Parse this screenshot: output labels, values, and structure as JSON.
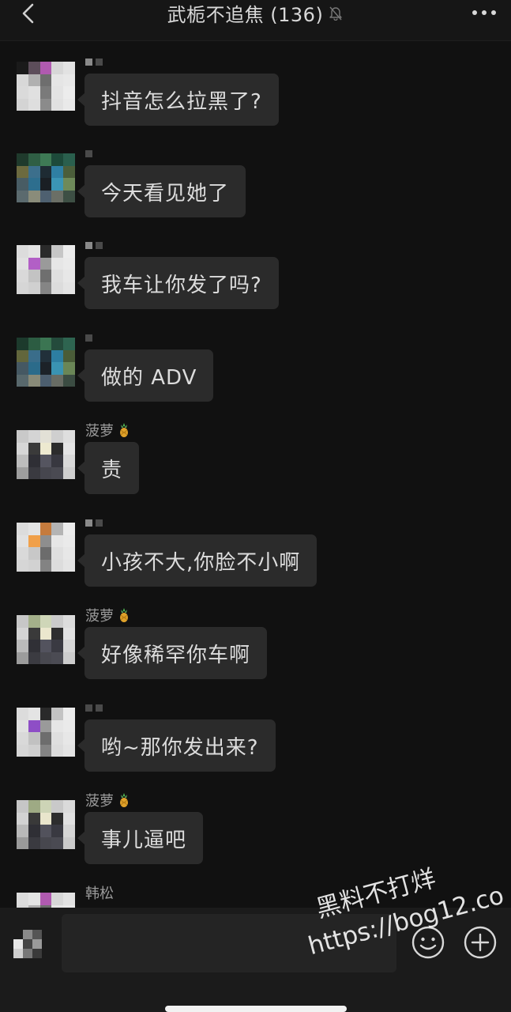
{
  "header": {
    "back_icon": "chevron-left-icon",
    "title": "武栀不追焦 (136)",
    "mute_icon": "bell-muted-icon",
    "more_icon": "more-dots-icon"
  },
  "messages": [
    {
      "sender": "",
      "text": "抖音怎么拉黑了?",
      "avatar": "pixelated"
    },
    {
      "sender": "",
      "text": "今天看见她了",
      "avatar": "pixelated"
    },
    {
      "sender": "",
      "text": "我车让你发了吗?",
      "avatar": "pixelated"
    },
    {
      "sender": "",
      "text": "做的 ADV",
      "avatar": "pixelated"
    },
    {
      "sender": "菠萝",
      "sender_icon": "pineapple-icon",
      "text": "责",
      "avatar": "pixelated"
    },
    {
      "sender": "",
      "text": "小孩不大,你脸不小啊",
      "avatar": "pixelated"
    },
    {
      "sender": "菠萝",
      "sender_icon": "pineapple-icon",
      "text": "好像稀罕你车啊",
      "avatar": "pixelated"
    },
    {
      "sender": "",
      "text": "哟~那你发出来?",
      "avatar": "pixelated"
    },
    {
      "sender": "菠萝",
      "sender_icon": "pineapple-icon",
      "text": "事儿逼吧",
      "avatar": "pixelated"
    },
    {
      "sender": "韩松",
      "text": "",
      "avatar": "pixelated"
    }
  ],
  "input_bar": {
    "voice_icon": "voice-icon",
    "input_value": "",
    "emoji_icon": "emoji-icon",
    "plus_icon": "plus-icon"
  },
  "watermark": {
    "line1": "黑料不打烊",
    "line2": "https://bog12.co"
  },
  "colors": {
    "background": "#111111",
    "header": "#161616",
    "bubble": "#2b2b2b",
    "text": "#dcdcdc",
    "sender_name": "#9a9a9a",
    "input_bar": "#1b1b1b"
  }
}
